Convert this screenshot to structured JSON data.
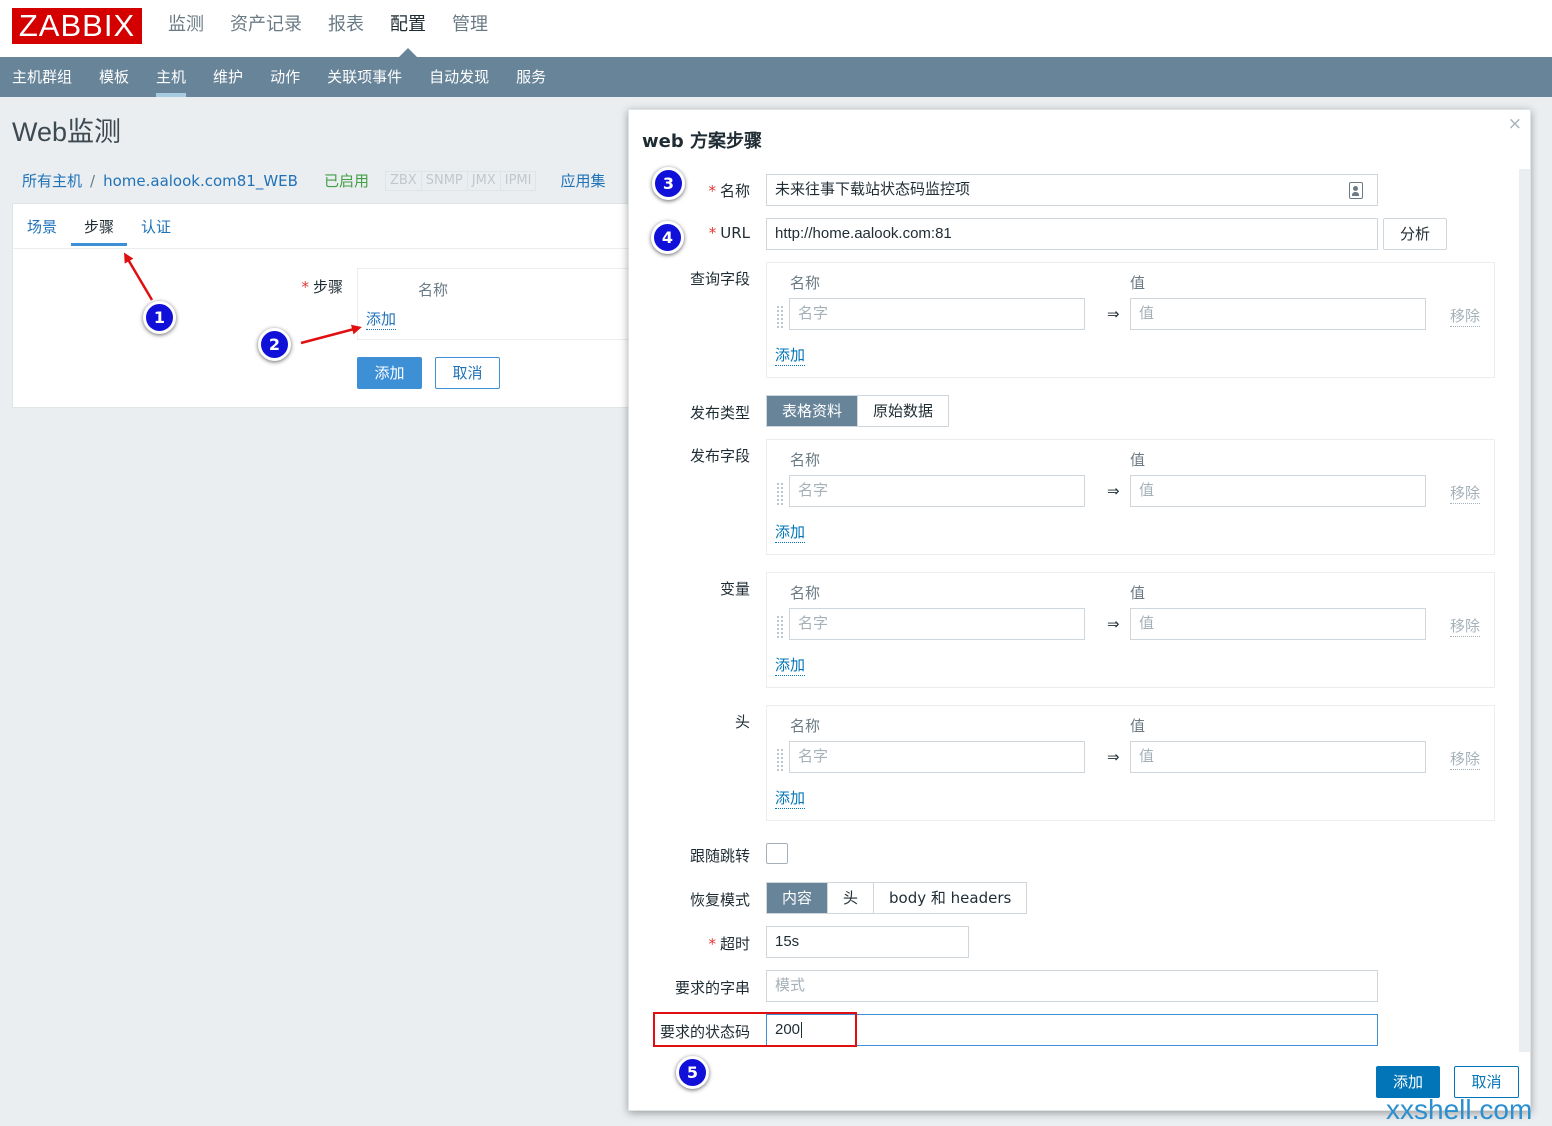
{
  "header": {
    "logo": "ZABBIX",
    "main_menu": [
      "监测",
      "资产记录",
      "报表",
      "配置",
      "管理"
    ],
    "sub_menu": [
      "主机群组",
      "模板",
      "主机",
      "维护",
      "动作",
      "关联项事件",
      "自动发现",
      "服务"
    ]
  },
  "page": {
    "title": "Web监测",
    "breadcrumb": {
      "all_hosts": "所有主机",
      "separator": "/",
      "host": "home.aalook.com81_WEB",
      "status": "已启用",
      "availability": [
        "ZBX",
        "SNMP",
        "JMX",
        "IPMI"
      ],
      "app_link": "应用集"
    },
    "tabs": [
      "场景",
      "步骤",
      "认证"
    ],
    "steps": {
      "required_mark": "*",
      "label": "步骤",
      "column_name": "名称",
      "add_link": "添加"
    },
    "add_button": "添加",
    "cancel_button": "取消"
  },
  "modal": {
    "title": "web 方案步骤",
    "close": "×",
    "required_mark": "*",
    "name": {
      "label": "名称",
      "value": "未来往事下载站状态码监控项"
    },
    "url": {
      "label": "URL",
      "value": "http://home.aalook.com:81",
      "parse_button": "分析"
    },
    "query_fields": {
      "label": "查询字段"
    },
    "post_type": {
      "label": "发布类型",
      "options": [
        "表格资料",
        "原始数据"
      ],
      "selected": "表格资料"
    },
    "post_fields": {
      "label": "发布字段"
    },
    "variables": {
      "label": "变量"
    },
    "headers": {
      "label": "头"
    },
    "kv_common": {
      "col_name": "名称",
      "col_value": "值",
      "name_placeholder": "名字",
      "value_placeholder": "值",
      "arrow": "⇒",
      "remove": "移除",
      "add": "添加"
    },
    "follow_redirects": {
      "label": "跟随跳转",
      "checked": false
    },
    "retrieve_mode": {
      "label": "恢复模式",
      "options": [
        "内容",
        "头",
        "body 和 headers"
      ],
      "selected": "内容"
    },
    "timeout": {
      "label": "超时",
      "value": "15s"
    },
    "required_string": {
      "label": "要求的字串",
      "placeholder": "模式"
    },
    "status_codes": {
      "label": "要求的状态码",
      "value": "200"
    },
    "add_button": "添加",
    "cancel_button": "取消"
  },
  "annotations": {
    "badges": [
      "1",
      "2",
      "3",
      "4",
      "5"
    ],
    "highlight_color": "#e01010"
  },
  "watermark": "xxshell.com",
  "colors": {
    "brand": "#d40000",
    "nav": "#678499",
    "link": "#1f72b8",
    "primary": "#0275b8",
    "enabled": "#429e47"
  }
}
